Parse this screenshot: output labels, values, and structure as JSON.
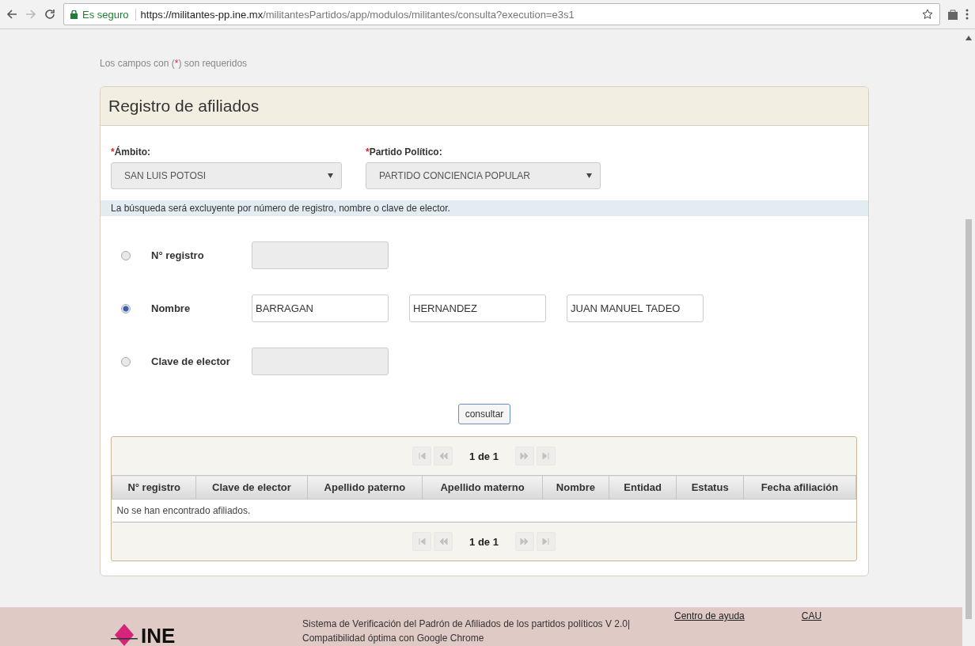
{
  "browser": {
    "security": "Es seguro",
    "url_host": "https://militantes-pp.ine.mx",
    "url_path": "/militantesPartidos/app/modulos/militantes/consulta?execution=e3s1"
  },
  "required_note": {
    "before": "Los campos con (",
    "mark": "*",
    "after": ") son requeridos"
  },
  "panel": {
    "title": "Registro de afiliados",
    "selects": [
      {
        "required_mark": "*",
        "label": "Ámbito:",
        "value": "SAN LUIS POTOSI"
      },
      {
        "required_mark": "*",
        "label": "Partido Político:",
        "value": "PARTIDO CONCIENCIA POPULAR"
      }
    ],
    "info": "La búsqueda será excluyente por número de registro, nombre o clave de elector.",
    "options": [
      {
        "label": "N° registro",
        "selected": false,
        "fields": [
          {
            "disabled": true
          }
        ]
      },
      {
        "label": "Nombre",
        "selected": true,
        "fields": [
          {
            "value": "BARRAGAN",
            "disabled": false
          },
          {
            "value": "HERNANDEZ",
            "disabled": false
          },
          {
            "value": "JUAN MANUEL TADEO",
            "disabled": false
          }
        ]
      },
      {
        "label": "Clave de elector",
        "selected": false,
        "fields": [
          {
            "disabled": true
          }
        ]
      }
    ],
    "button": "consultar",
    "results": {
      "pager_top": {
        "text": "1 de 1",
        "buttons": [
          {
            "kind": "first",
            "disabled": true
          },
          {
            "kind": "prev",
            "disabled": true
          },
          {
            "kind": "next",
            "disabled": true
          },
          {
            "kind": "last",
            "disabled": true
          }
        ]
      },
      "columns": [
        "N° registro",
        "Clave de elector",
        "Apellido paterno",
        "Apellido materno",
        "Nombre",
        "Entidad",
        "Estatus",
        "Fecha afiliación"
      ],
      "empty_message": "No se han encontrado afiliados.",
      "pager_bottom": {
        "text": "1 de 1",
        "buttons": [
          {
            "kind": "first",
            "disabled": true
          },
          {
            "kind": "prev",
            "disabled": true
          },
          {
            "kind": "next",
            "disabled": true
          },
          {
            "kind": "last",
            "disabled": true
          }
        ]
      }
    }
  },
  "footer": {
    "logo": "INE",
    "lines": [
      "Sistema de Verificación del Padrón de Afiliados de los partidos políticos V 2.0|",
      "Compatibilidad óptima con Google Chrome"
    ],
    "links": [
      "Centro de ayuda",
      "CAU"
    ]
  }
}
